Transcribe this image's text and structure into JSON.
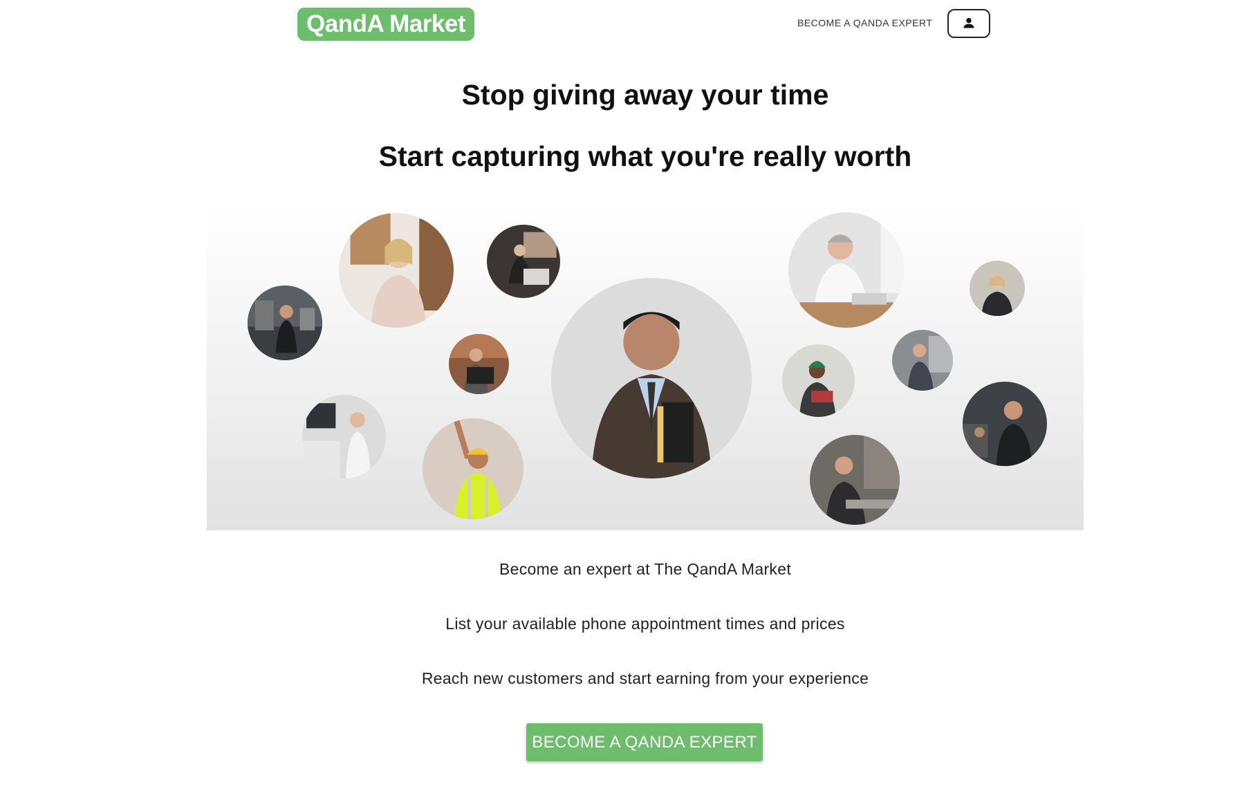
{
  "header": {
    "logo": "QandA Market",
    "nav_link": "BECOME A QANDA EXPERT",
    "account_icon": "person-icon"
  },
  "hero": {
    "headline": "Stop giving away your time",
    "subheadline": "Start capturing what you're really worth",
    "photos": [
      "mechanic-photo",
      "businesswoman-photo",
      "laptop-woman-photo",
      "student-laptop-photo",
      "lab-woman-photo",
      "construction-worker-photo",
      "businessman-photo",
      "doctor-photo",
      "teacher-photo",
      "craftsman-photo",
      "executive-woman-photo",
      "chef-photo",
      "woodworker-photo"
    ]
  },
  "body": {
    "line1": "Become an expert at The QandA Market",
    "line2": "List your available phone appointment times and prices",
    "line3": "Reach new customers and start earning from your experience"
  },
  "cta": {
    "label": "BECOME A QANDA EXPERT"
  },
  "colors": {
    "brand_green": "#6dbd6c",
    "text": "#111111"
  }
}
